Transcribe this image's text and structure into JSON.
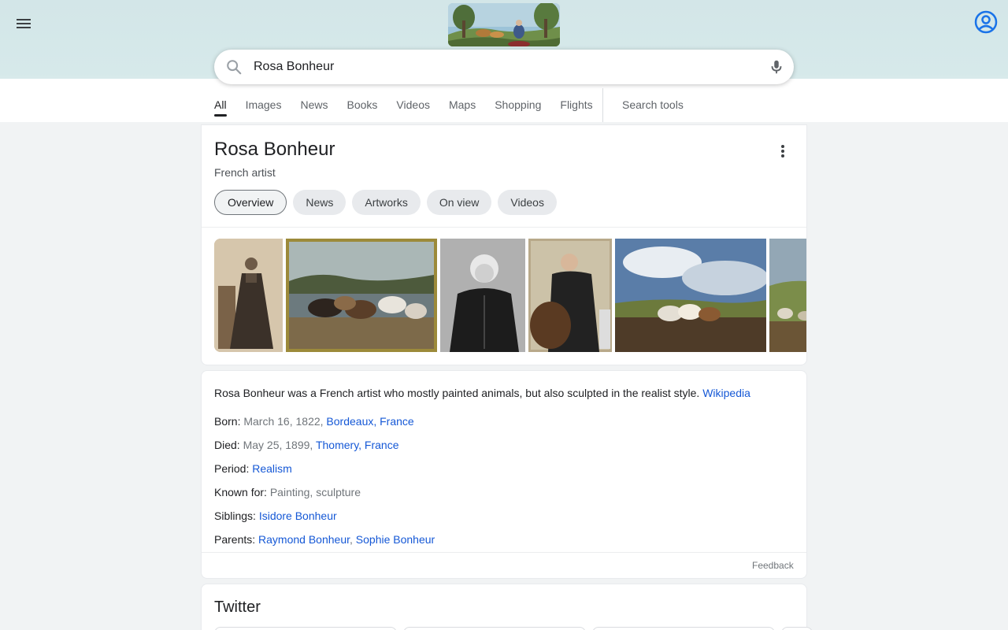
{
  "header": {
    "menu_icon": "hamburger-menu-icon",
    "account_icon": "account-circle-icon",
    "doodle_alt": "painting-doodle"
  },
  "search": {
    "query": "Rosa Bonheur",
    "placeholder": "",
    "search_icon": "search-icon",
    "mic_icon": "microphone-icon"
  },
  "tabs": [
    {
      "label": "All",
      "active": true
    },
    {
      "label": "Images"
    },
    {
      "label": "News"
    },
    {
      "label": "Books"
    },
    {
      "label": "Videos"
    },
    {
      "label": "Maps"
    },
    {
      "label": "Shopping"
    },
    {
      "label": "Flights"
    }
  ],
  "search_tools_label": "Search tools",
  "knowledge_panel": {
    "title": "Rosa Bonheur",
    "subtitle": "French artist",
    "chips": [
      {
        "label": "Overview",
        "active": true
      },
      {
        "label": "News"
      },
      {
        "label": "Artworks"
      },
      {
        "label": "On view"
      },
      {
        "label": "Videos"
      }
    ],
    "description": "Rosa Bonheur was a French artist who mostly painted animals, but also sculpted in the realist style.",
    "source_link": "Wikipedia",
    "facts": {
      "born": {
        "label": "Born:",
        "value": "March 16, 1822,",
        "link": "Bordeaux, France"
      },
      "died": {
        "label": "Died:",
        "value": "May 25, 1899,",
        "link": "Thomery, France"
      },
      "period": {
        "label": "Period:",
        "link": "Realism"
      },
      "known_for": {
        "label": "Known for:",
        "value": "Painting, sculpture"
      },
      "siblings": {
        "label": "Siblings:",
        "link": "Isidore Bonheur"
      },
      "parents": {
        "label": "Parents:",
        "link1": "Raymond Bonheur",
        "sep": ",",
        "link2": "Sophie Bonheur"
      }
    },
    "feedback_label": "Feedback"
  },
  "twitter": {
    "title": "Twitter"
  },
  "colors": {
    "link": "#1558d6",
    "header_bg": "#d3e6e8",
    "page_bg": "#f1f3f4"
  }
}
